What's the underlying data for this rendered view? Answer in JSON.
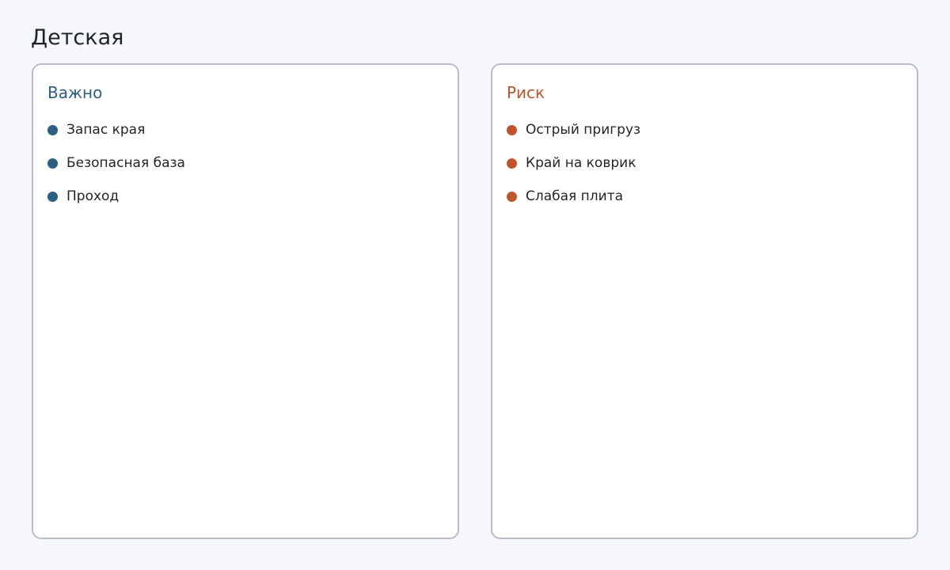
{
  "page": {
    "title": "Детская"
  },
  "panels": [
    {
      "title": "Важно",
      "accent": "#2b5f83",
      "items": [
        {
          "label": "Запас края",
          "icon": "dot-bullet-icon"
        },
        {
          "label": "Безопасная база",
          "icon": "dot-bullet-icon"
        },
        {
          "label": "Проход",
          "icon": "dot-bullet-icon"
        }
      ]
    },
    {
      "title": "Риск",
      "accent": "#c1542a",
      "items": [
        {
          "label": "Острый пригруз",
          "icon": "dot-bullet-icon"
        },
        {
          "label": "Край на коврик",
          "icon": "dot-bullet-icon"
        },
        {
          "label": "Слабая плита",
          "icon": "dot-bullet-icon"
        }
      ]
    }
  ]
}
